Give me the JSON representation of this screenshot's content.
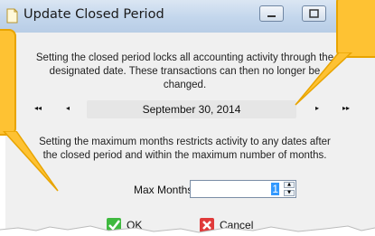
{
  "window": {
    "title": "Update Closed Period"
  },
  "description_top": "Setting the closed period locks all accounting activity through the designated date. These transactions can then no longer be changed.",
  "description_top_lines": [
    "Setting the closed period locks all accounting activity through the",
    "designated date. These transactions can then no longer be",
    "changed."
  ],
  "date_nav": {
    "first_glyph": "◂◂",
    "prev_glyph": "◂",
    "next_glyph": "▸",
    "last_glyph": "▸▸",
    "date_label": "September 30, 2014"
  },
  "description_bottom_lines": [
    "Setting the maximum months restricts activity to any dates after",
    "the closed period and within the maximum number of months."
  ],
  "max_months": {
    "label": "Max Months:",
    "value": "1"
  },
  "buttons": {
    "ok_label": "OK",
    "cancel_label": "Cancel"
  },
  "icons": [
    "document-icon",
    "minimize-icon",
    "maximize-icon",
    "checkmark-icon",
    "x-icon"
  ],
  "colors": {
    "callout": "#fec233",
    "titlebar": "#c3d6ec",
    "selection": "#3399ff"
  }
}
